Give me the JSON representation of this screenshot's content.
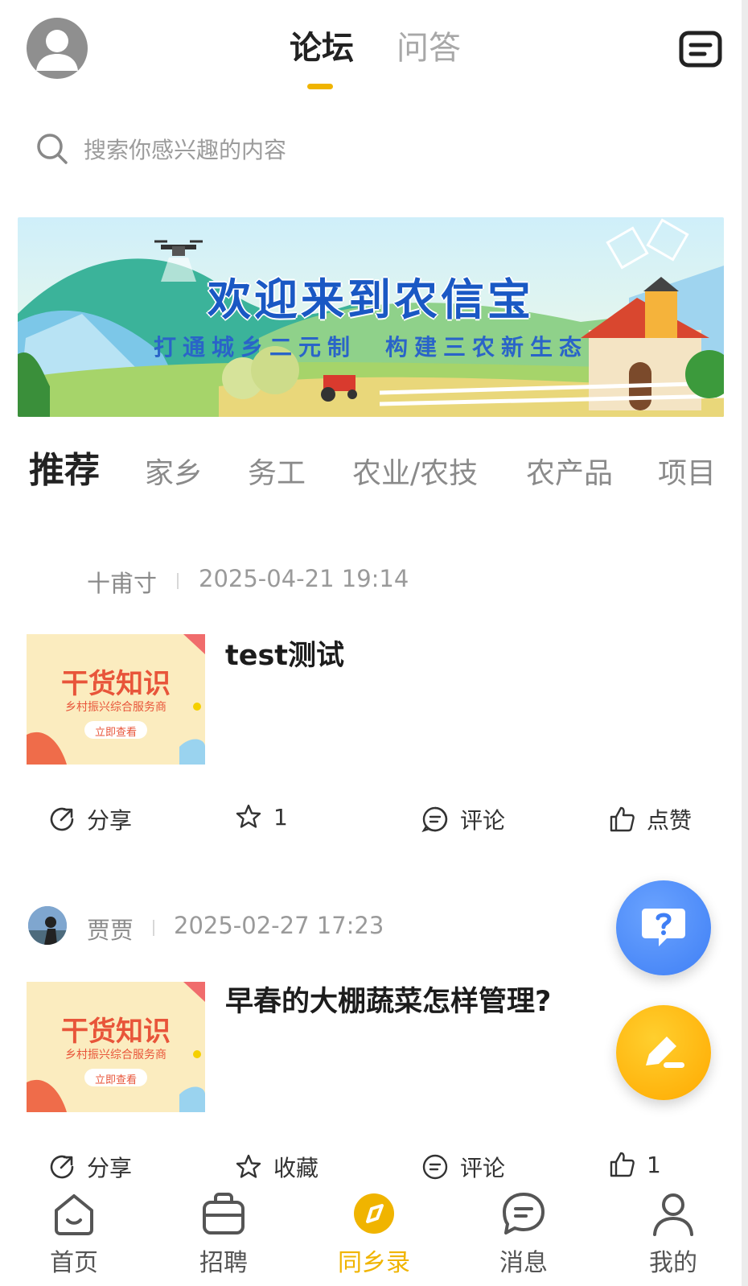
{
  "header": {
    "tabs": [
      {
        "label": "论坛",
        "active": true
      },
      {
        "label": "问答",
        "active": false
      }
    ],
    "accent_color": "#f0b400"
  },
  "search": {
    "placeholder": "搜索你感兴趣的内容",
    "value": ""
  },
  "banner": {
    "title": "欢迎来到农信宝",
    "subtitle": "打通城乡二元制　构建三农新生态"
  },
  "categories": [
    {
      "label": "推荐",
      "active": true
    },
    {
      "label": "家乡",
      "active": false
    },
    {
      "label": "务工",
      "active": false
    },
    {
      "label": "农业/农技",
      "active": false
    },
    {
      "label": "农产品",
      "active": false
    },
    {
      "label": "项目",
      "active": false
    }
  ],
  "posts": [
    {
      "author": "十甫寸",
      "time": "2025-04-21 19:14",
      "title": "test测试",
      "thumb": {
        "title": "干货知识",
        "sub": "乡村振兴综合服务商",
        "button": "立即查看"
      },
      "actions": {
        "share": "分享",
        "favorite": "1",
        "comment": "评论",
        "like": "点赞"
      }
    },
    {
      "author": "贾贾",
      "time": "2025-02-27 17:23",
      "title": "早春的大棚蔬菜怎样管理?",
      "thumb": {
        "title": "干货知识",
        "sub": "乡村振兴综合服务商",
        "button": "立即查看"
      },
      "actions": {
        "share": "分享",
        "favorite": "收藏",
        "comment": "评论",
        "like": "1"
      }
    }
  ],
  "bottom_nav": [
    {
      "label": "首页",
      "icon": "home-icon",
      "active": false
    },
    {
      "label": "招聘",
      "icon": "briefcase-icon",
      "active": false
    },
    {
      "label": "同乡录",
      "icon": "compass-icon",
      "active": true
    },
    {
      "label": "消息",
      "icon": "message-icon",
      "active": false
    },
    {
      "label": "我的",
      "icon": "user-icon",
      "active": false
    }
  ]
}
